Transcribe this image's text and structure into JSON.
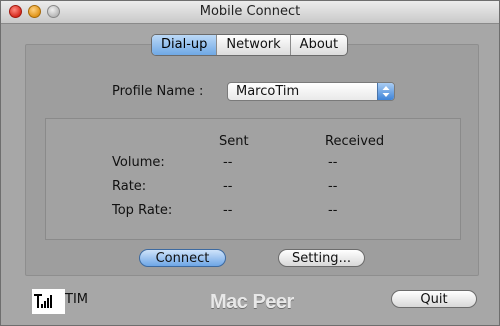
{
  "window": {
    "title": "Mobile Connect"
  },
  "tabs": [
    {
      "label": "Dial-up",
      "active": true
    },
    {
      "label": "Network",
      "active": false
    },
    {
      "label": "About",
      "active": false
    }
  ],
  "profile": {
    "label": "Profile Name :",
    "selected": "MarcoTim"
  },
  "stats": {
    "col_sent": "Sent",
    "col_received": "Received",
    "rows": [
      {
        "label": "Volume:",
        "sent": "--",
        "received": "--"
      },
      {
        "label": "Rate:",
        "sent": "--",
        "received": "--"
      },
      {
        "label": "Top Rate:",
        "sent": "--",
        "received": "--"
      }
    ]
  },
  "buttons": {
    "connect": "Connect",
    "setting": "Setting...",
    "quit": "Quit"
  },
  "status": {
    "carrier": "TIM",
    "signal_icon": "signal-bars-icon"
  },
  "brand": {
    "text": "Mac Peer"
  },
  "colors": {
    "accent": "#6ea6e6",
    "window_bg": "#a7a7a7"
  }
}
